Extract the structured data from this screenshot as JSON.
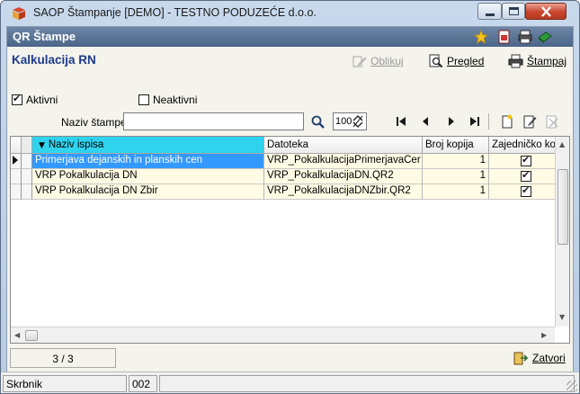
{
  "window": {
    "title": "SAOP Štampanje [DEMO] - TESTNO PODUZEĆE d.o.o."
  },
  "header": {
    "title": "QR Štampe"
  },
  "form": {
    "title": "Kalkulacija RN",
    "edit_label": "Oblikuj",
    "preview_label": "Pregled",
    "print_label": "Štampaj",
    "active_label": "Aktivni",
    "active_checked": true,
    "inactive_label": "Neaktivni",
    "inactive_checked": false
  },
  "search": {
    "label": "Naziv štampe",
    "value": "",
    "zoom": "100"
  },
  "grid": {
    "columns": [
      "Naziv ispisa",
      "Datoteka",
      "Broj kopija",
      "Zajedničko kor"
    ],
    "rows": [
      {
        "name": "Primerjava dejanskih in planskih cen",
        "file": "VRP_PokalkulacijaPrimerjavaCer",
        "copies": "1",
        "shared": true
      },
      {
        "name": "VRP Pokalkulacija DN",
        "file": "VRP_PokalkulacijaDN.QR2",
        "copies": "1",
        "shared": true
      },
      {
        "name": "VRP Pokalkulacija DN Zbir",
        "file": "VRP_PokalkulacijaDNZbir.QR2",
        "copies": "1",
        "shared": true
      }
    ]
  },
  "footer": {
    "counter": "3 / 3",
    "close_label": "Zatvori"
  },
  "status": {
    "user": "Skrbnik",
    "code": "002"
  }
}
